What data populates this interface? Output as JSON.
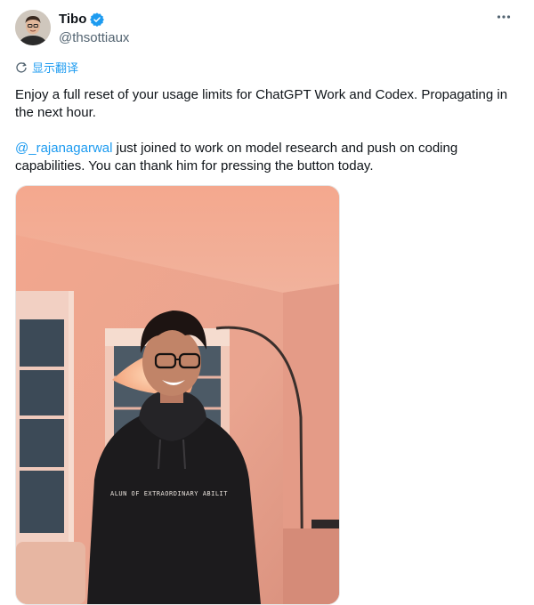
{
  "author": {
    "display_name": "Tibo",
    "handle": "@thsottiaux",
    "avatar_icon": "avatar-photo",
    "verified_icon": "verified-badge-icon"
  },
  "translate": {
    "label": "显示翻译",
    "icon": "translate-icon"
  },
  "menu": {
    "icon": "more-icon"
  },
  "tweet": {
    "paragraph1": "Enjoy a full reset of your usage limits for ChatGPT Work and Codex. Propagating in the next hour.",
    "mention": "@_rajanagarwal",
    "paragraph2_rest": " just joined to work on model research and push on coding capabilities. You can thank him for pressing the button today."
  },
  "photo": {
    "hoodie_text": "ALUN OF EXTRAORDINARY ABILIT"
  },
  "colors": {
    "accent": "#1d9bf0",
    "text": "#0f1419",
    "muted": "#536471"
  }
}
